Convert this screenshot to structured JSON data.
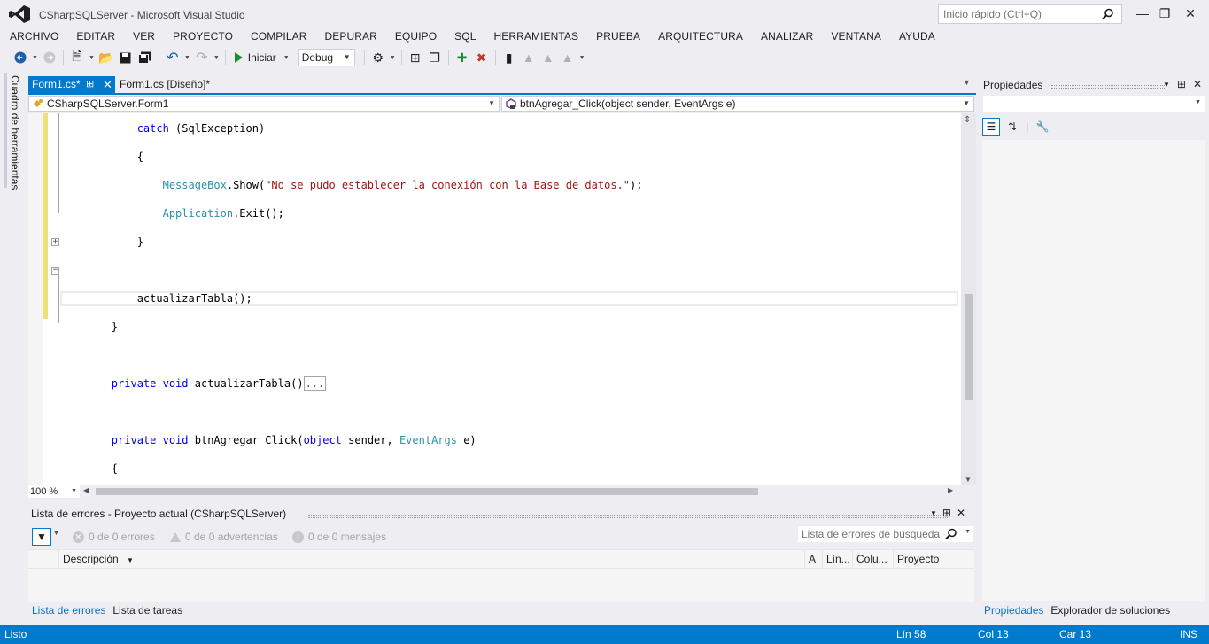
{
  "window": {
    "title": "CSharpSQLServer - Microsoft Visual Studio",
    "quick_launch_placeholder": "Inicio rápido (Ctrl+Q)"
  },
  "menu": [
    "ARCHIVO",
    "EDITAR",
    "VER",
    "PROYECTO",
    "COMPILAR",
    "DEPURAR",
    "EQUIPO",
    "SQL",
    "HERRAMIENTAS",
    "PRUEBA",
    "ARQUITECTURA",
    "ANALIZAR",
    "VENTANA",
    "AYUDA"
  ],
  "toolbar": {
    "start_label": "Iniciar",
    "configuration": "Debug"
  },
  "toolbox": {
    "label": "Cuadro de herramientas"
  },
  "tabs": [
    {
      "label": "Form1.cs*",
      "active": true
    },
    {
      "label": "Form1.cs [Diseño]*",
      "active": false
    }
  ],
  "navbar": {
    "class": "CSharpSQLServer.Form1",
    "member": "btnAgregar_Click(object sender, EventArgs e)"
  },
  "code": {
    "catch_kw": "catch",
    "catch_rest": " (SqlException)",
    "open_brace": "{",
    "close_brace": "}",
    "msgbox_type": "MessageBox",
    "msgbox_call": ".Show(",
    "msgbox_string": "\"No se pudo establecer la conexión con la Base de datos.\"",
    "msgbox_end": ");",
    "app_type": "Application",
    "app_call": ".Exit();",
    "update_call": "actualizarTabla();",
    "private_kw": "private",
    "void_kw": "void",
    "method1_name": " actualizarTabla()",
    "collapsed_text": "...",
    "method2_name": " btnAgregar_Click(",
    "object_kw": "object",
    "param1": " sender, ",
    "eventargs_type": "EventArgs",
    "param2": " e)"
  },
  "zoom": "100 %",
  "error_list": {
    "title": "Lista de errores - Proyecto actual (CSharpSQLServer)",
    "errors": "0 de 0 errores",
    "warnings": "0 de 0 advertencias",
    "messages": "0 de 0 mensajes",
    "search_placeholder": "Lista de errores de búsqueda",
    "columns": [
      "Descripción",
      "A",
      "Lín...",
      "Colu...",
      "Proyecto"
    ]
  },
  "bottom_tabs": [
    "Lista de errores",
    "Lista de tareas"
  ],
  "properties": {
    "title": "Propiedades",
    "tabs": [
      "Propiedades",
      "Explorador de soluciones"
    ]
  },
  "status": {
    "state": "Listo",
    "line": "Lín 58",
    "col": "Col 13",
    "char": "Car 13",
    "mode": "INS"
  },
  "colors": {
    "accent": "#007ACC",
    "keyword": "#0000FF",
    "type": "#2B91AF",
    "string": "#A31515"
  }
}
